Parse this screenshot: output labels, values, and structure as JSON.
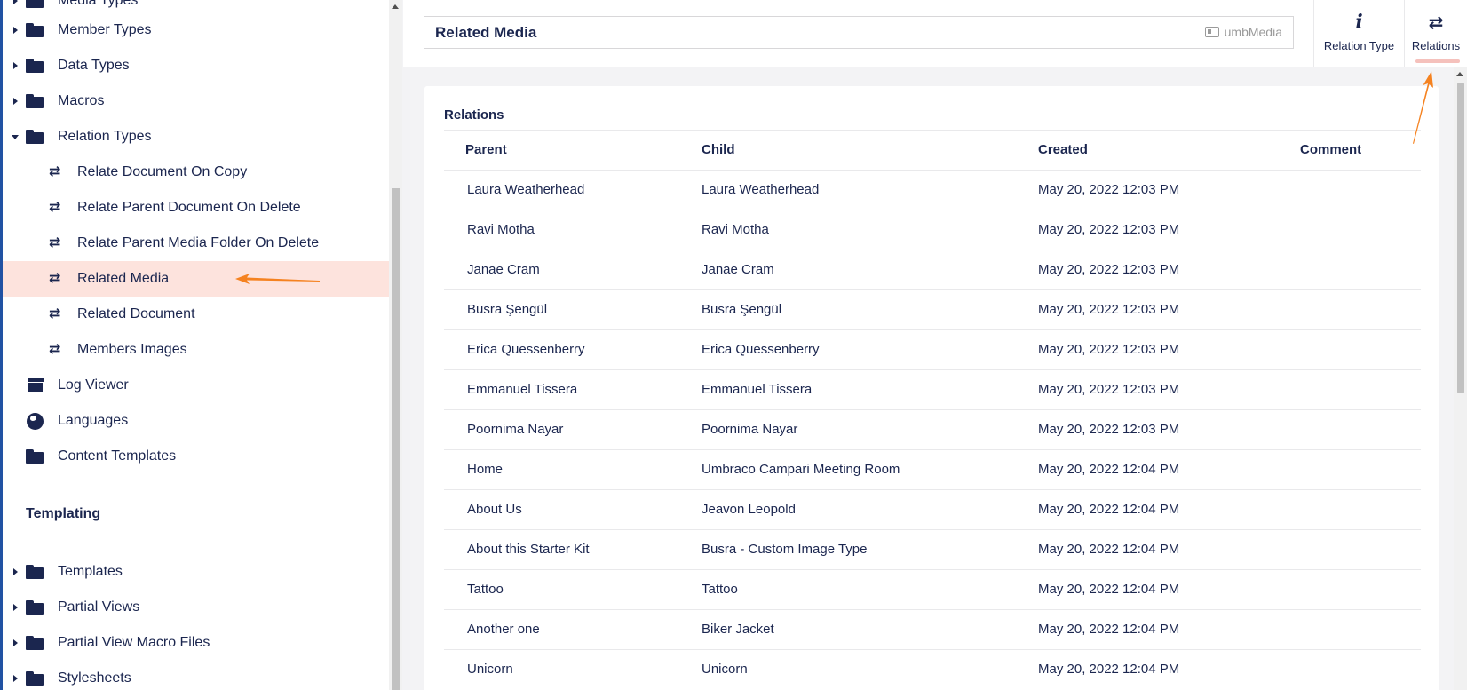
{
  "tree": {
    "items": [
      {
        "label": "Media Types",
        "icon": "folder-icon",
        "expanded": false
      },
      {
        "label": "Member Types",
        "icon": "folder-icon",
        "expanded": false
      },
      {
        "label": "Data Types",
        "icon": "folder-icon",
        "expanded": false
      },
      {
        "label": "Macros",
        "icon": "folder-icon",
        "expanded": false
      },
      {
        "label": "Relation Types",
        "icon": "folder-icon",
        "expanded": true
      },
      {
        "label": "Relate Document On Copy",
        "icon": "relation-icon"
      },
      {
        "label": "Relate Parent Document On Delete",
        "icon": "relation-icon"
      },
      {
        "label": "Relate Parent Media Folder On Delete",
        "icon": "relation-icon"
      },
      {
        "label": "Related Media",
        "icon": "relation-icon",
        "selected": true
      },
      {
        "label": "Related Document",
        "icon": "relation-icon"
      },
      {
        "label": "Members Images",
        "icon": "relation-icon"
      },
      {
        "label": "Log Viewer",
        "icon": "archive-icon"
      },
      {
        "label": "Languages",
        "icon": "globe-icon"
      },
      {
        "label": "Content Templates",
        "icon": "folder-icon"
      }
    ],
    "templating_title": "Templating",
    "templating_items": [
      {
        "label": "Templates",
        "icon": "folder-icon"
      },
      {
        "label": "Partial Views",
        "icon": "folder-icon"
      },
      {
        "label": "Partial View Macro Files",
        "icon": "folder-icon"
      },
      {
        "label": "Stylesheets",
        "icon": "folder-icon"
      }
    ]
  },
  "header": {
    "name": "Related Media",
    "alias": "umbMedia",
    "apps": [
      {
        "label": "Relation Type",
        "icon": "info-icon",
        "glyph": "i"
      },
      {
        "label": "Relations",
        "icon": "swap-icon",
        "glyph": "⇄",
        "active": true
      }
    ]
  },
  "relations": {
    "title": "Relations",
    "columns": [
      "Parent",
      "Child",
      "Created",
      "Comment"
    ],
    "rows": [
      {
        "parent": "Laura Weatherhead",
        "child": "Laura Weatherhead",
        "created": "May 20, 2022 12:03 PM",
        "comment": ""
      },
      {
        "parent": "Ravi Motha",
        "child": "Ravi Motha",
        "created": "May 20, 2022 12:03 PM",
        "comment": ""
      },
      {
        "parent": "Janae Cram",
        "child": "Janae Cram",
        "created": "May 20, 2022 12:03 PM",
        "comment": ""
      },
      {
        "parent": "Busra Şengül",
        "child": "Busra Şengül",
        "created": "May 20, 2022 12:03 PM",
        "comment": ""
      },
      {
        "parent": "Erica Quessenberry",
        "child": "Erica Quessenberry",
        "created": "May 20, 2022 12:03 PM",
        "comment": ""
      },
      {
        "parent": "Emmanuel Tissera",
        "child": "Emmanuel Tissera",
        "created": "May 20, 2022 12:03 PM",
        "comment": ""
      },
      {
        "parent": "Poornima Nayar",
        "child": "Poornima Nayar",
        "created": "May 20, 2022 12:03 PM",
        "comment": ""
      },
      {
        "parent": "Home",
        "child": "Umbraco Campari Meeting Room",
        "created": "May 20, 2022 12:04 PM",
        "comment": ""
      },
      {
        "parent": "About Us",
        "child": "Jeavon Leopold",
        "created": "May 20, 2022 12:04 PM",
        "comment": ""
      },
      {
        "parent": "About this Starter Kit",
        "child": "Busra - Custom Image Type",
        "created": "May 20, 2022 12:04 PM",
        "comment": ""
      },
      {
        "parent": "Tattoo",
        "child": "Tattoo",
        "created": "May 20, 2022 12:04 PM",
        "comment": ""
      },
      {
        "parent": "Another one",
        "child": "Biker Jacket",
        "created": "May 20, 2022 12:04 PM",
        "comment": ""
      },
      {
        "parent": "Unicorn",
        "child": "Unicorn",
        "created": "May 20, 2022 12:04 PM",
        "comment": ""
      }
    ]
  },
  "colors": {
    "text": "#1b264f",
    "selected_bg": "#fde3dd",
    "annotation_arrow": "#f58220",
    "tab_underline": "#f5c1bc"
  }
}
